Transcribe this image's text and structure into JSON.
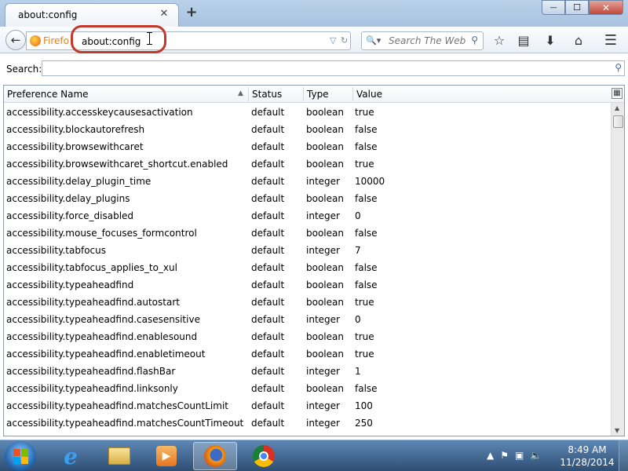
{
  "window": {
    "tab_title": "about:config",
    "tab_close_glyph": "✕",
    "new_tab_glyph": "+",
    "minimize_glyph": "—",
    "maximize_glyph": "☐",
    "close_glyph": "✕"
  },
  "navbar": {
    "identity_label": "Firefo",
    "url_value": "about:config",
    "search_placeholder": "Search The Web",
    "icons": [
      "back-icon",
      "bookmark-star-icon",
      "bookmarks-list-icon",
      "downloads-icon",
      "home-icon",
      "menu-icon"
    ]
  },
  "search": {
    "label": "Search:",
    "value": ""
  },
  "table": {
    "columns": [
      "Preference Name",
      "Status",
      "Type",
      "Value"
    ],
    "rows": [
      {
        "name": "accessibility.accesskeycausesactivation",
        "status": "default",
        "type": "boolean",
        "value": "true"
      },
      {
        "name": "accessibility.blockautorefresh",
        "status": "default",
        "type": "boolean",
        "value": "false"
      },
      {
        "name": "accessibility.browsewithcaret",
        "status": "default",
        "type": "boolean",
        "value": "false"
      },
      {
        "name": "accessibility.browsewithcaret_shortcut.enabled",
        "status": "default",
        "type": "boolean",
        "value": "true"
      },
      {
        "name": "accessibility.delay_plugin_time",
        "status": "default",
        "type": "integer",
        "value": "10000"
      },
      {
        "name": "accessibility.delay_plugins",
        "status": "default",
        "type": "boolean",
        "value": "false"
      },
      {
        "name": "accessibility.force_disabled",
        "status": "default",
        "type": "integer",
        "value": "0"
      },
      {
        "name": "accessibility.mouse_focuses_formcontrol",
        "status": "default",
        "type": "boolean",
        "value": "false"
      },
      {
        "name": "accessibility.tabfocus",
        "status": "default",
        "type": "integer",
        "value": "7"
      },
      {
        "name": "accessibility.tabfocus_applies_to_xul",
        "status": "default",
        "type": "boolean",
        "value": "false"
      },
      {
        "name": "accessibility.typeaheadfind",
        "status": "default",
        "type": "boolean",
        "value": "false"
      },
      {
        "name": "accessibility.typeaheadfind.autostart",
        "status": "default",
        "type": "boolean",
        "value": "true"
      },
      {
        "name": "accessibility.typeaheadfind.casesensitive",
        "status": "default",
        "type": "integer",
        "value": "0"
      },
      {
        "name": "accessibility.typeaheadfind.enablesound",
        "status": "default",
        "type": "boolean",
        "value": "true"
      },
      {
        "name": "accessibility.typeaheadfind.enabletimeout",
        "status": "default",
        "type": "boolean",
        "value": "true"
      },
      {
        "name": "accessibility.typeaheadfind.flashBar",
        "status": "default",
        "type": "integer",
        "value": "1"
      },
      {
        "name": "accessibility.typeaheadfind.linksonly",
        "status": "default",
        "type": "boolean",
        "value": "false"
      },
      {
        "name": "accessibility.typeaheadfind.matchesCountLimit",
        "status": "default",
        "type": "integer",
        "value": "100"
      },
      {
        "name": "accessibility.typeaheadfind.matchesCountTimeout",
        "status": "default",
        "type": "integer",
        "value": "250"
      }
    ]
  },
  "taskbar": {
    "apps": [
      "internet-explorer-icon",
      "windows-explorer-icon",
      "media-player-icon",
      "firefox-icon",
      "chrome-icon"
    ],
    "clock_time": "8:49 AM",
    "clock_date": "11/28/2014"
  },
  "colors": {
    "highlight_ring": "#c0392b",
    "firefox_orange": "#e0801c"
  }
}
